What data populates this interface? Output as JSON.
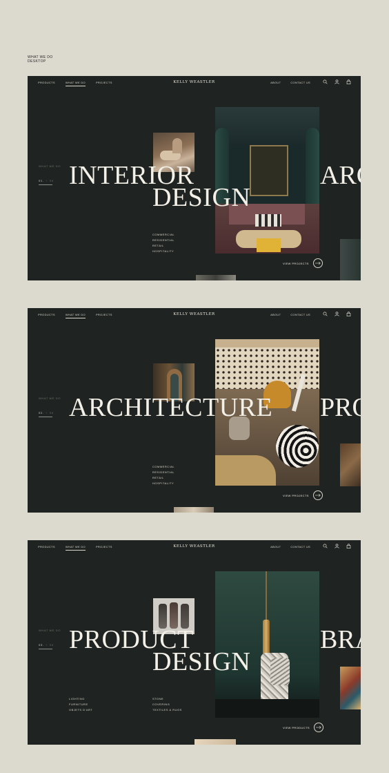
{
  "page_label": {
    "line1": "WHAT WE DO",
    "line2": "DESKTOP"
  },
  "screens": [
    {
      "nav": {
        "products": "PRODUCTS",
        "what_we_do": "WHAT WE DO",
        "projects": "PROJECTS",
        "brand": "KELLY WEASTLER",
        "about": "ABOUT",
        "contact": "CONTACT US"
      },
      "side_label": "WHAT WE DO",
      "counter": {
        "current": "01.",
        "total": "04"
      },
      "headline": {
        "line1": "INTERIOR",
        "line2": "DESIGN"
      },
      "next_word": "ARC",
      "list_a": [
        "COMMERCIAL",
        "RESIDENTIAL",
        "RETAIL",
        "HOSPITALITY"
      ],
      "list_b": [],
      "cta": "VIEW PROJECTS"
    },
    {
      "nav": {
        "products": "PRODUCTS",
        "what_we_do": "WHAT WE DO",
        "projects": "PROJECTS",
        "brand": "KELLY WEASTLER",
        "about": "ABOUT",
        "contact": "CONTACT US"
      },
      "side_label": "WHAT WE DO",
      "counter": {
        "current": "02.",
        "total": "04"
      },
      "headline": {
        "line1": "ARCHITECTURE",
        "line2": ""
      },
      "next_word": "PRO",
      "list_a": [
        "COMMERCIAL",
        "RESIDENTIAL",
        "RETAIL",
        "HOSPITALITY"
      ],
      "list_b": [],
      "cta": "VIEW PROJECTS"
    },
    {
      "nav": {
        "products": "PRODUCTS",
        "what_we_do": "WHAT WE DO",
        "projects": "PROJECTS",
        "brand": "KELLY WEASTLER",
        "about": "ABOUT",
        "contact": "CONTACT US"
      },
      "side_label": "WHAT WE DO",
      "counter": {
        "current": "03.",
        "total": "04"
      },
      "headline": {
        "line1": "PRODUCT",
        "line2": "DESIGN"
      },
      "next_word": "BRA",
      "list_a": [
        "LIGHTING",
        "FURNITURE",
        "OBJETS D'ART"
      ],
      "list_b": [
        "STONE",
        "COVERING",
        "TEXTILES & RUGS"
      ],
      "cta": "VIEW PRODUCTS"
    }
  ],
  "icons": [
    "search-icon",
    "user-icon",
    "bag-icon",
    "arrow-right-icon"
  ],
  "colors": {
    "background": "#dcd9cf",
    "frame": "#1f2321",
    "text": "#f3f0e8"
  }
}
